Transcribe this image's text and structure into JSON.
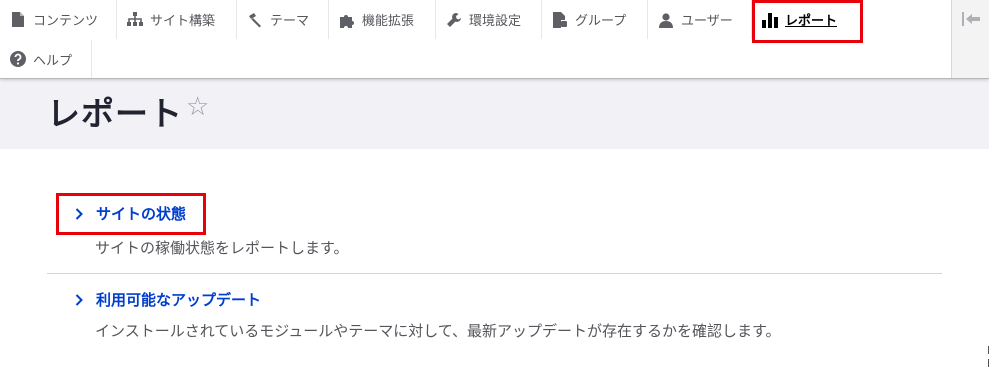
{
  "toolbar": {
    "items": [
      {
        "label": "コンテンツ",
        "icon": "content-icon"
      },
      {
        "label": "サイト構築",
        "icon": "sitemap-icon"
      },
      {
        "label": "テーマ",
        "icon": "brush-icon"
      },
      {
        "label": "機能拡張",
        "icon": "puzzle-icon"
      },
      {
        "label": "環境設定",
        "icon": "wrench-icon"
      },
      {
        "label": "グループ",
        "icon": "group-icon"
      },
      {
        "label": "ユーザー",
        "icon": "user-icon"
      },
      {
        "label": "レポート",
        "icon": "bar-chart-icon",
        "active": true
      },
      {
        "label": "ヘルプ",
        "icon": "help-icon"
      }
    ],
    "collapse_icon": "collapse-arrow-icon"
  },
  "page": {
    "title": "レポート",
    "star": "☆"
  },
  "admin_list": [
    {
      "title": "サイトの状態",
      "description": "サイトの稼働状態をレポートします。"
    },
    {
      "title": "利用可能なアップデート",
      "description": "インストールされているモジュールやテーマに対して、最新アップデートが存在するかを確認します。"
    }
  ],
  "colors": {
    "link": "#003ecc",
    "highlight": "#e8000a",
    "header_bg": "#f2f2f6"
  }
}
